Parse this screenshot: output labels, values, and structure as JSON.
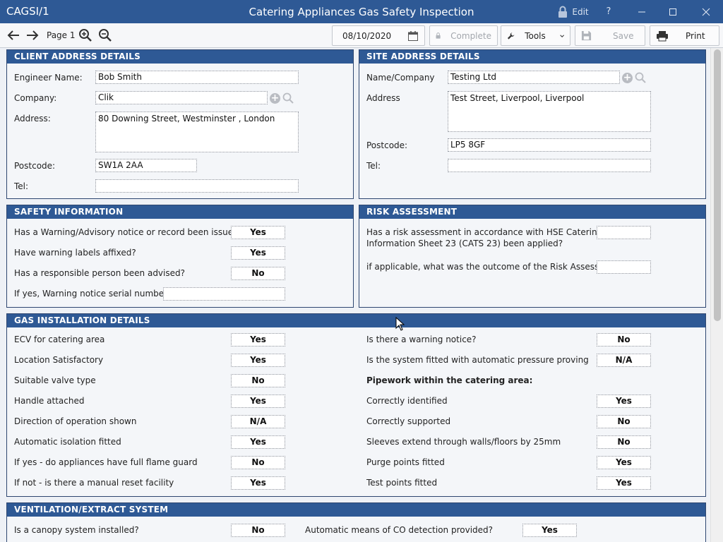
{
  "window": {
    "app_id": "CAGSI/1",
    "title": "Catering Appliances Gas Safety Inspection",
    "edit_label": "Edit",
    "help_label": "?"
  },
  "toolbar": {
    "page_label": "Page 1",
    "date_value": "08/10/2020",
    "complete_label": "Complete",
    "tools_label": "Tools",
    "save_label": "Save",
    "print_label": "Print"
  },
  "client": {
    "header": "CLIENT ADDRESS DETAILS",
    "engineer_label": "Engineer Name:",
    "engineer_value": "Bob Smith",
    "company_label": "Company:",
    "company_value": "Clik",
    "address_label": "Address:",
    "address_value": "80 Downing Street, Westminster , London",
    "postcode_label": "Postcode:",
    "postcode_value": "SW1A 2AA",
    "tel_label": "Tel:",
    "tel_value": ""
  },
  "site": {
    "header": "SITE ADDRESS DETAILS",
    "name_label": "Name/Company",
    "name_value": "Testing Ltd",
    "address_label": "Address",
    "address_value": "Test Street, Liverpool, Liverpool",
    "postcode_label": "Postcode:",
    "postcode_value": "LP5 8GF",
    "tel_label": "Tel:",
    "tel_value": ""
  },
  "safety": {
    "header": "SAFETY INFORMATION",
    "q1": "Has a Warning/Advisory notice or record been issued?",
    "a1": "Yes",
    "q2": "Have warning labels affixed?",
    "a2": "Yes",
    "q3": "Has a responsible person been advised?",
    "a3": "No",
    "q4": "If yes, Warning notice serial number",
    "a4": ""
  },
  "risk": {
    "header": "RISK ASSESSMENT",
    "q1_line1": "Has a risk assessment in accordance with HSE Catering",
    "q1_line2": "Information Sheet 23 (CATS 23) been applied?",
    "a1": "",
    "q2": "if applicable, what was the outcome of the Risk Assessment?",
    "a2": ""
  },
  "gas": {
    "header": "GAS INSTALLATION DETAILS",
    "left": [
      {
        "q": "ECV for catering area",
        "a": "Yes"
      },
      {
        "q": "Location Satisfactory",
        "a": "Yes"
      },
      {
        "q": "Suitable valve type",
        "a": "No"
      },
      {
        "q": "Handle attached",
        "a": "Yes"
      },
      {
        "q": "Direction of operation shown",
        "a": "N/A"
      },
      {
        "q": "Automatic isolation fitted",
        "a": "Yes"
      },
      {
        "q": "If yes - do appliances have full flame guard",
        "a": "No"
      },
      {
        "q": "If not - is there a manual reset facility",
        "a": "Yes"
      }
    ],
    "right": [
      {
        "q": "Is there a warning notice?",
        "a": "No"
      },
      {
        "q": "Is the system fitted with automatic pressure proving",
        "a": "N/A"
      },
      {
        "q": "Pipework within the catering area:",
        "a": ""
      },
      {
        "q": "Correctly identified",
        "a": "Yes"
      },
      {
        "q": "Correctly supported",
        "a": "No"
      },
      {
        "q": "Sleeves extend through walls/floors by 25mm",
        "a": "No"
      },
      {
        "q": "Purge points fitted",
        "a": "Yes"
      },
      {
        "q": "Test points fitted",
        "a": "Yes"
      }
    ]
  },
  "vent": {
    "header": "VENTILATION/EXTRACT SYSTEM",
    "q1": "Is a canopy system installed?",
    "a1": "No",
    "q2": "Automatic means of CO detection provided?",
    "a2": "Yes"
  },
  "colors": {
    "header_blue": "#2e5995",
    "border": "#2e4670"
  }
}
